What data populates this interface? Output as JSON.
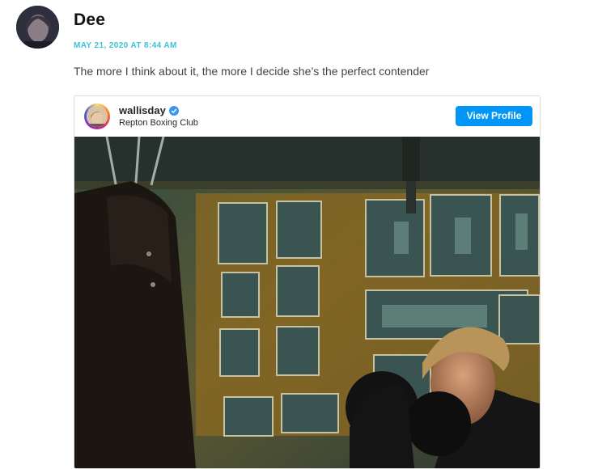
{
  "comment": {
    "author": "Dee",
    "timestamp": "MAY 21, 2020 AT 8:44 AM",
    "text": "The more I think about it, the more I decide she’s the perfect contender"
  },
  "instagram_embed": {
    "username": "wallisday",
    "verified": true,
    "location": "Repton Boxing Club",
    "view_profile_label": "View Profile",
    "accent_color": "#0095f6"
  },
  "colors": {
    "timestamp": "#3ac2d6",
    "verified_badge": "#3897f0"
  }
}
